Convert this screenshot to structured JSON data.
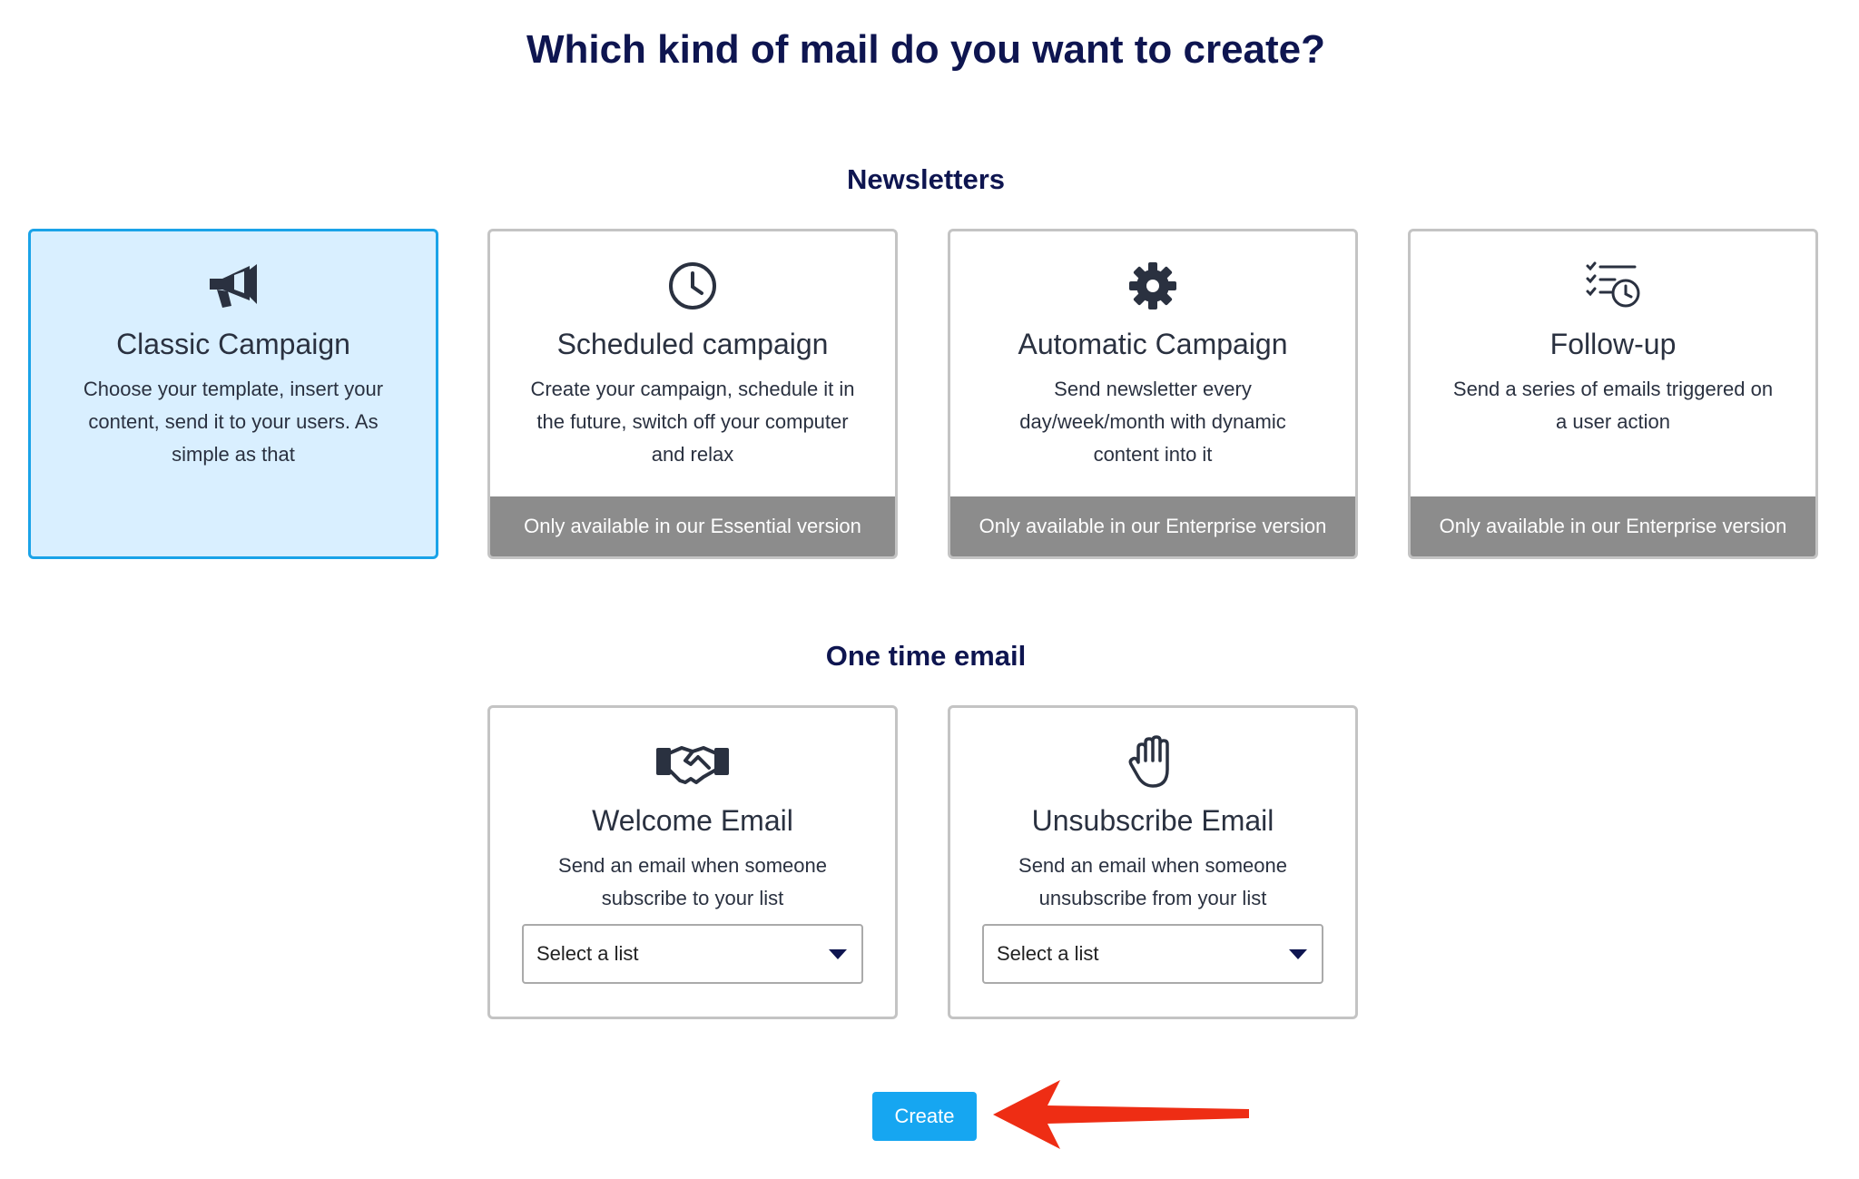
{
  "header": {
    "title": "Which kind of mail do you want to create?"
  },
  "sections": {
    "newsletters": "Newsletters",
    "one_time": "One time email"
  },
  "newsletter_cards": [
    {
      "icon": "megaphone-icon",
      "title": "Classic Campaign",
      "description": "Choose your template, insert your content, send it to your users. As simple as that",
      "footer": "",
      "selected": true
    },
    {
      "icon": "clock-icon",
      "title": "Scheduled campaign",
      "description": "Create your campaign, schedule it in the future, switch off your computer and relax",
      "footer": "Only available in our Essential version",
      "selected": false
    },
    {
      "icon": "gear-icon",
      "title": "Automatic Campaign",
      "description": "Send newsletter every day/week/month with dynamic content into it",
      "footer": "Only available in our Enterprise version",
      "selected": false
    },
    {
      "icon": "checklist-clock-icon",
      "title": "Follow-up",
      "description": "Send a series of emails triggered on a user action",
      "footer": "Only available in our Enterprise version",
      "selected": false
    }
  ],
  "onetime_cards": [
    {
      "icon": "handshake-icon",
      "title": "Welcome Email",
      "description": "Send an email when someone subscribe to your list",
      "select_value": "Select a list"
    },
    {
      "icon": "hand-stop-icon",
      "title": "Unsubscribe Email",
      "description": "Send an email when someone unsubscribe from your list",
      "select_value": "Select a list"
    }
  ],
  "actions": {
    "create_label": "Create"
  },
  "colors": {
    "heading": "#0e1550",
    "selected_bg": "#d9efff",
    "selected_border": "#1aa3e8",
    "footer_bg": "#8c8c8c",
    "button_bg": "#16a6f1",
    "arrow": "#ee2d14"
  }
}
